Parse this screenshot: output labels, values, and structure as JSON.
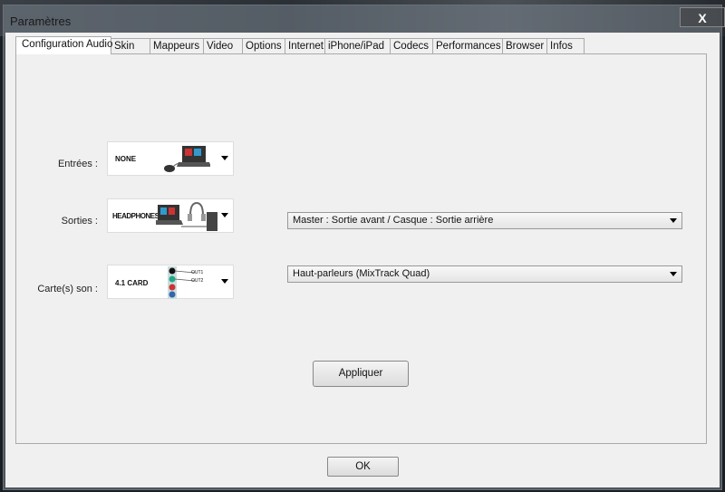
{
  "window": {
    "title": "Paramètres",
    "close_label": "X"
  },
  "tabs": [
    {
      "label": "Configuration Audio",
      "active": true
    },
    {
      "label": "Skin"
    },
    {
      "label": "Mappeurs"
    },
    {
      "label": "Video"
    },
    {
      "label": "Options"
    },
    {
      "label": "Internet"
    },
    {
      "label": "iPhone/iPad"
    },
    {
      "label": "Codecs"
    },
    {
      "label": "Performances"
    },
    {
      "label": "Browser"
    },
    {
      "label": "Infos"
    }
  ],
  "audio": {
    "inputs": {
      "label": "Entrées :",
      "value": "NONE"
    },
    "outputs": {
      "label": "Sorties :",
      "value": "HEADPHONES",
      "routing": "Master : Sortie avant / Casque : Sortie arrière"
    },
    "soundcard": {
      "label": "Carte(s) son :",
      "value": "4.1 CARD",
      "out1": "OUT1",
      "out2": "OUT2",
      "device": "Haut-parleurs (MixTrack Quad)"
    },
    "apply_label": "Appliquer"
  },
  "ok_label": "OK"
}
